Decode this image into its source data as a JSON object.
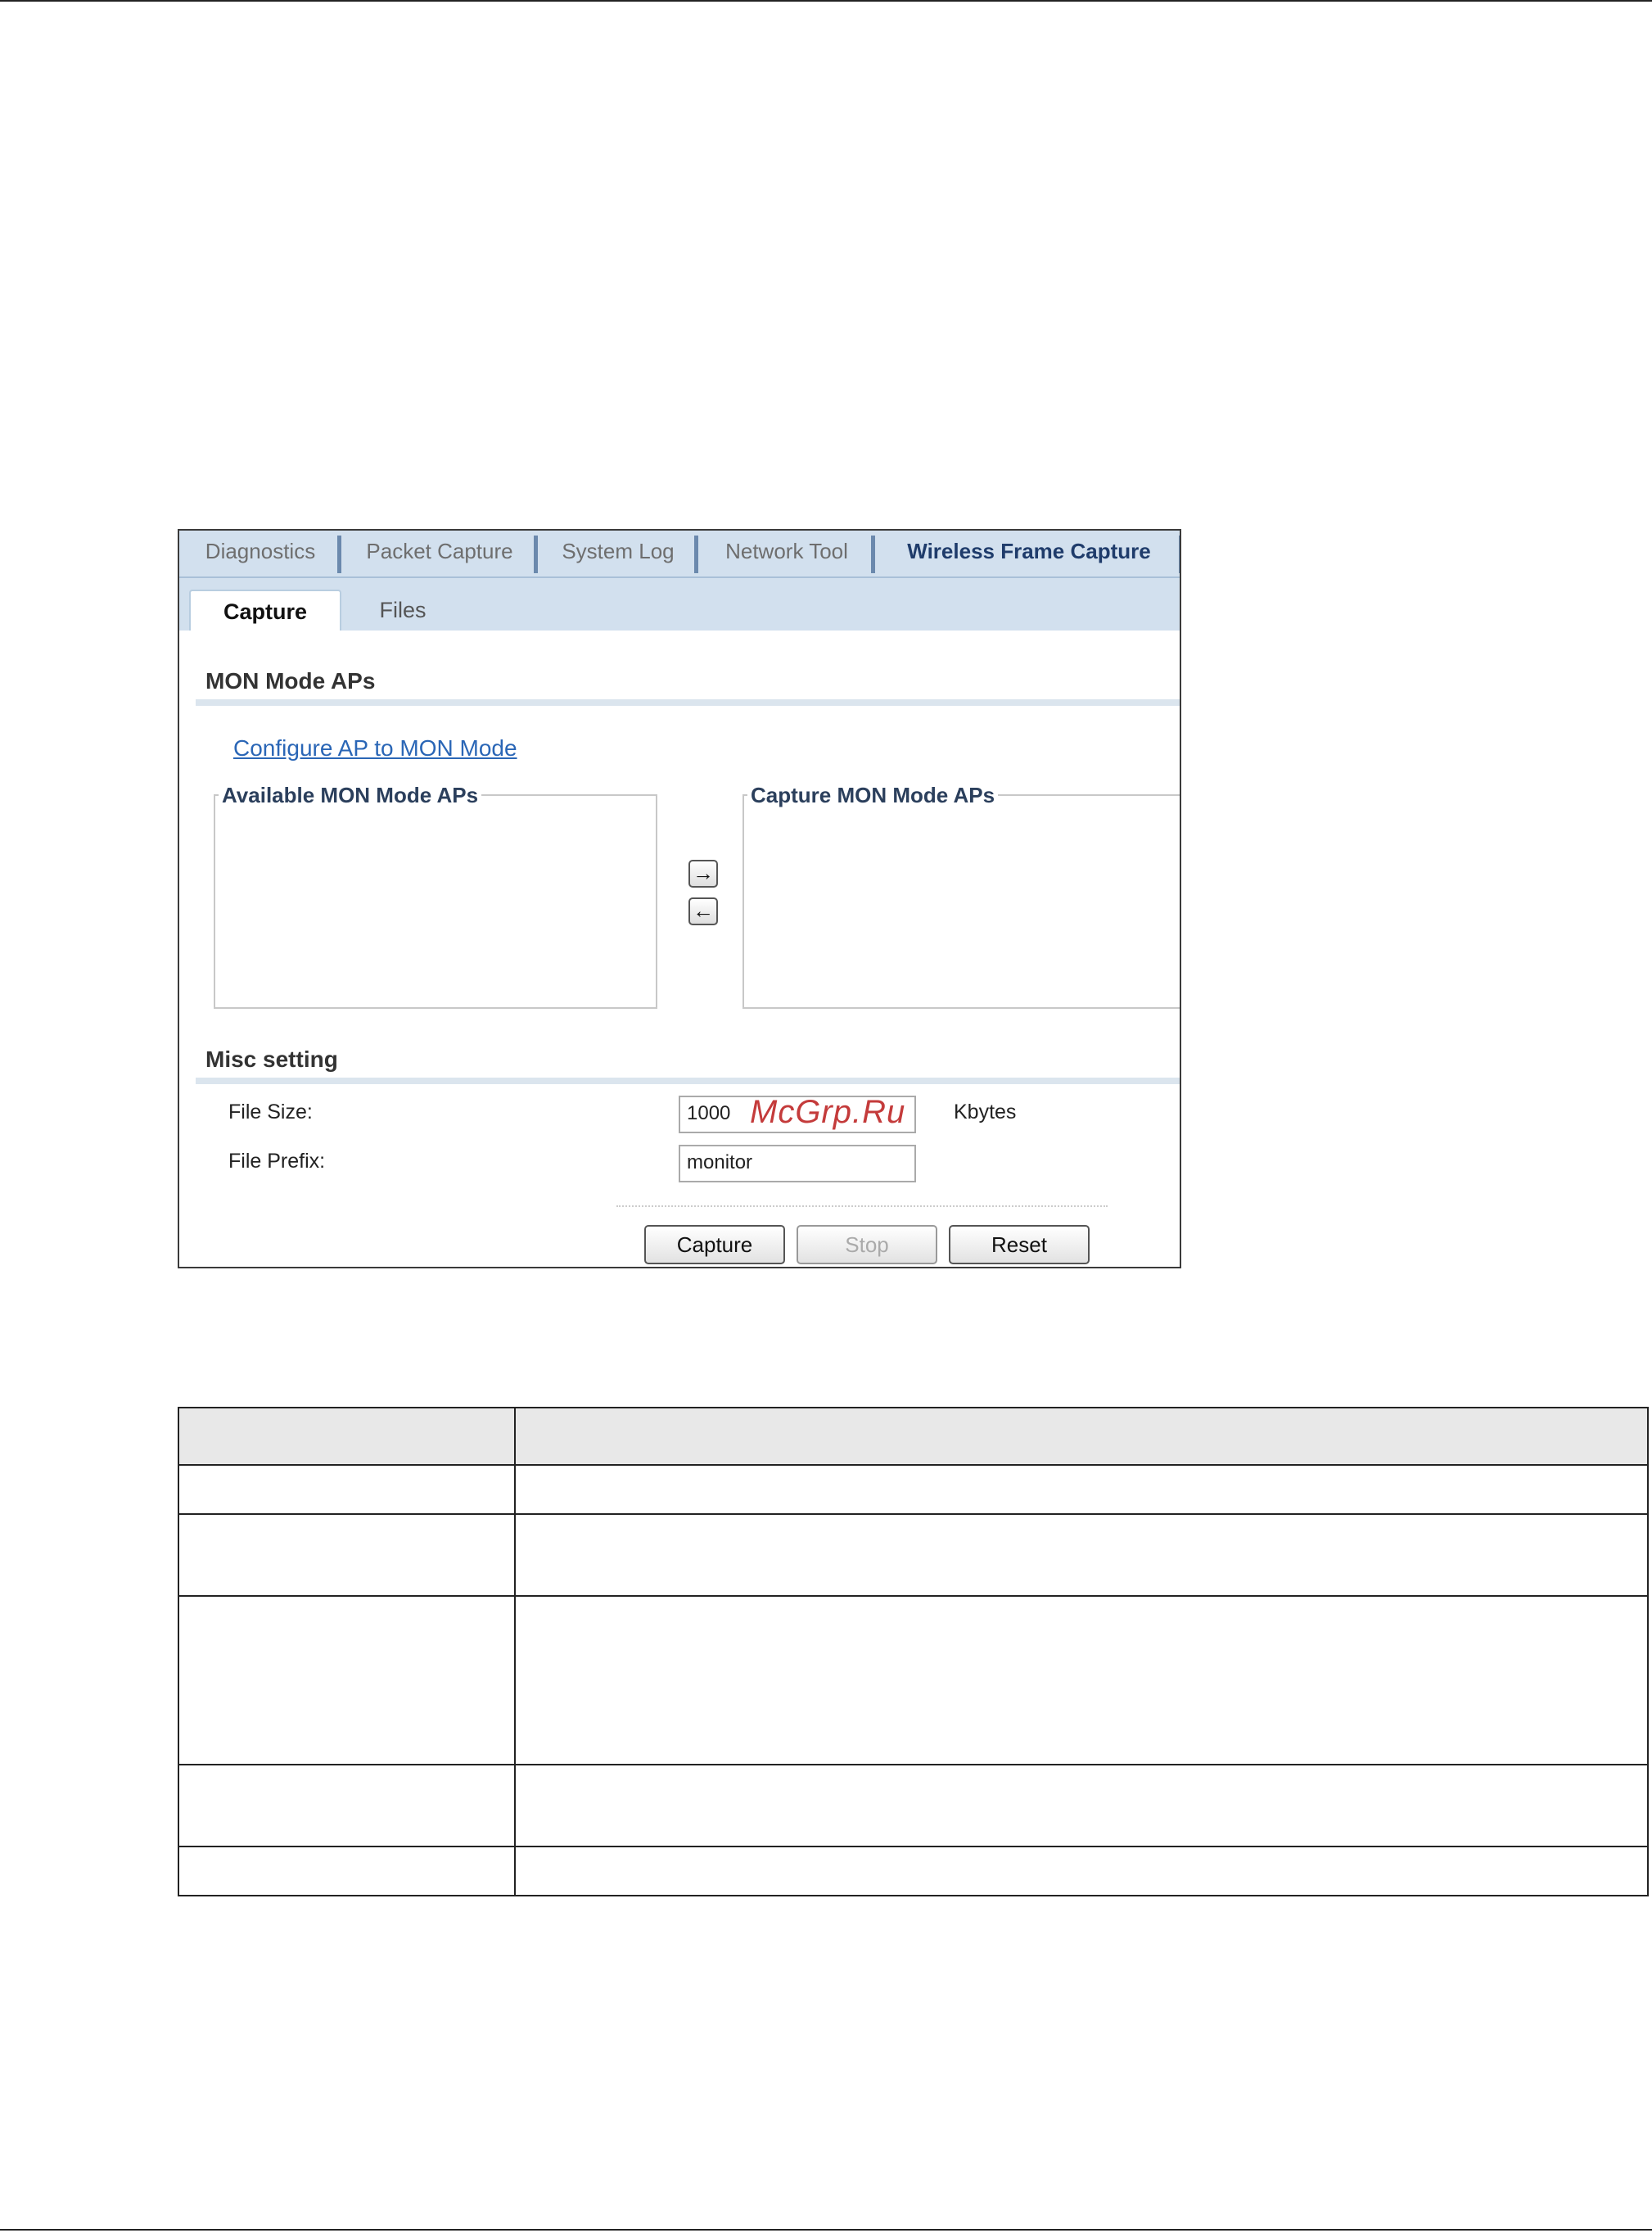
{
  "tabs": [
    {
      "label": "Diagnostics",
      "active": false
    },
    {
      "label": "Packet Capture",
      "active": false
    },
    {
      "label": "System Log",
      "active": false
    },
    {
      "label": "Network Tool",
      "active": false
    },
    {
      "label": "Wireless Frame Capture",
      "active": true
    }
  ],
  "subtabs": [
    {
      "label": "Capture",
      "active": true
    },
    {
      "label": "Files",
      "active": false
    }
  ],
  "mon_section": {
    "title": "MON Mode APs",
    "configure_link": "Configure AP to MON Mode",
    "available_label": "Available MON Mode APs",
    "capture_label": "Capture MON Mode APs",
    "add_icon": "right-arrow-icon",
    "remove_icon": "left-arrow-icon"
  },
  "misc_section": {
    "title": "Misc setting",
    "file_size_label": "File Size:",
    "file_size_value": "1000",
    "file_size_unit": "Kbytes",
    "file_prefix_label": "File Prefix:",
    "file_prefix_value": "monitor"
  },
  "buttons": {
    "capture": "Capture",
    "stop": "Stop",
    "reset": "Reset"
  },
  "watermark": "McGrp.Ru"
}
